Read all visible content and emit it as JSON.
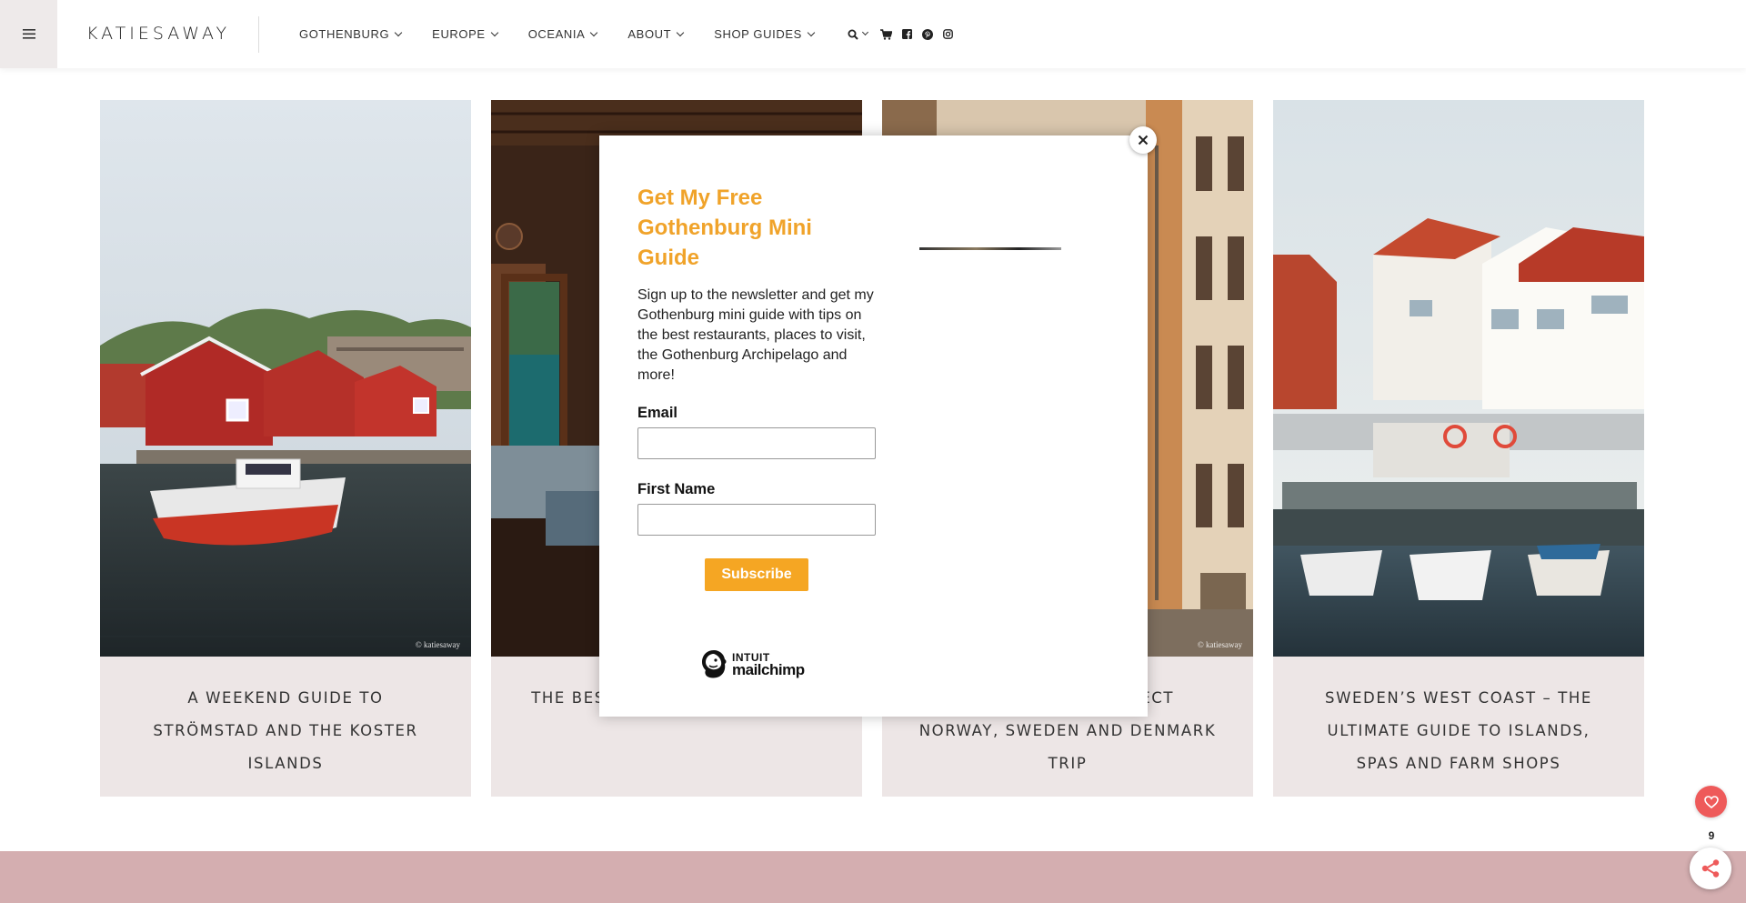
{
  "header": {
    "logo": "KATIESAWAY",
    "nav": [
      {
        "label": "GOTHENBURG"
      },
      {
        "label": "EUROPE"
      },
      {
        "label": "OCEANIA"
      },
      {
        "label": "ABOUT"
      },
      {
        "label": "SHOP GUIDES"
      }
    ],
    "icons": [
      "search-icon",
      "cart-icon",
      "facebook-icon",
      "pinterest-icon",
      "instagram-icon"
    ]
  },
  "cards": [
    {
      "title": "A WEEKEND GUIDE TO STRÖMSTAD AND THE KOSTER ISLANDS",
      "watermark": "© katiesaway"
    },
    {
      "title": "THE BES... ROAD TRIP ITINERARY"
    },
    {
      "title": "...ERARY – THE PERFECT NORWAY, SWEDEN AND DENMARK TRIP",
      "watermark": "© katiesaway"
    },
    {
      "title": "SWEDEN’S WEST COAST – THE ULTIMATE GUIDE TO ISLANDS, SPAS AND FARM SHOPS"
    }
  ],
  "popup": {
    "heading": "Get My Free Gothenburg Mini Guide",
    "description": "Sign up to the newsletter and get my Gothenburg mini guide with tips on the best restaurants, places to visit, the Gothenburg Archipelago and more!",
    "email_label": "Email",
    "email_value": "",
    "first_name_label": "First Name",
    "first_name_value": "",
    "subscribe_label": "Subscribe",
    "brand_top": "INTUIT",
    "brand_bottom": "mailchimp"
  },
  "share": {
    "count": "9"
  },
  "colors": {
    "accent": "#f0a32a",
    "button": "#f5a623",
    "card_bg": "#ede6e6",
    "footer_band": "#d4aeb0",
    "heart": "#ee5a5a"
  }
}
